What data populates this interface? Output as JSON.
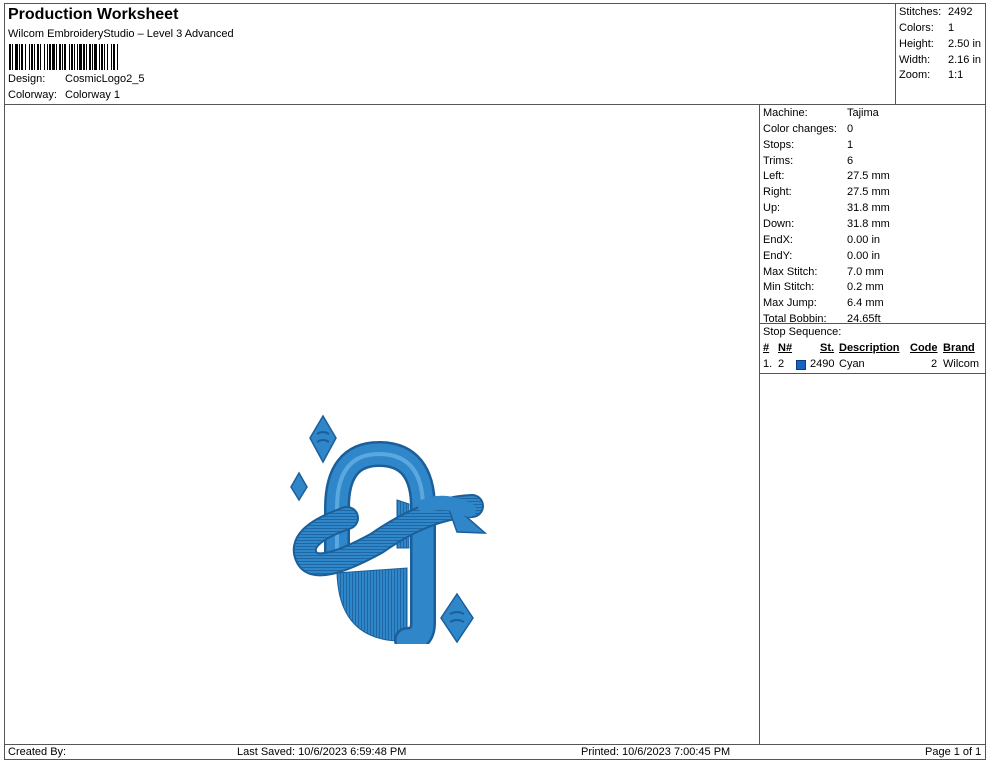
{
  "header": {
    "title": "Production Worksheet",
    "subtitle": "Wilcom EmbroideryStudio – Level 3 Advanced",
    "design_label": "Design:",
    "design_value": "CosmicLogo2_5",
    "colorway_label": "Colorway:",
    "colorway_value": "Colorway 1"
  },
  "summary": {
    "stitches_label": "Stitches:",
    "stitches_value": "2492",
    "colors_label": "Colors:",
    "colors_value": "1",
    "height_label": "Height:",
    "height_value": "2.50 in",
    "width_label": "Width:",
    "width_value": "2.16 in",
    "zoom_label": "Zoom:",
    "zoom_value": "1:1"
  },
  "details": [
    {
      "label": "Machine:",
      "value": "Tajima"
    },
    {
      "label": "Color changes:",
      "value": "0"
    },
    {
      "label": "Stops:",
      "value": "1"
    },
    {
      "label": "Trims:",
      "value": "6"
    },
    {
      "label": "Left:",
      "value": "27.5 mm"
    },
    {
      "label": "Right:",
      "value": "27.5 mm"
    },
    {
      "label": "Up:",
      "value": "31.8 mm"
    },
    {
      "label": "Down:",
      "value": "31.8 mm"
    },
    {
      "label": "EndX:",
      "value": "0.00 in"
    },
    {
      "label": "EndY:",
      "value": "0.00 in"
    },
    {
      "label": "Max Stitch:",
      "value": "7.0 mm"
    },
    {
      "label": "Min Stitch:",
      "value": "0.2 mm"
    },
    {
      "label": "Max Jump:",
      "value": "6.4 mm"
    },
    {
      "label": "Total Bobbin:",
      "value": "24.65ft"
    }
  ],
  "stop_sequence": {
    "title": "Stop Sequence:",
    "headers": {
      "num": "#",
      "n": "N#",
      "st": "St.",
      "description": "Description",
      "code": "Code",
      "brand": "Brand"
    },
    "rows": [
      {
        "num": "1.",
        "n": "2",
        "st": "2490",
        "description": "Cyan",
        "code": "2",
        "brand": "Wilcom",
        "color": "#1565c0"
      }
    ]
  },
  "footer": {
    "created_by": "Created By:",
    "last_saved": "Last Saved: 10/6/2023 6:59:48 PM",
    "printed": "Printed: 10/6/2023 7:00:45 PM",
    "page": "Page 1 of 1"
  },
  "design_colors": {
    "primary": "#2f86c8",
    "dark": "#1b5f9a",
    "light": "#5aa8e0"
  }
}
